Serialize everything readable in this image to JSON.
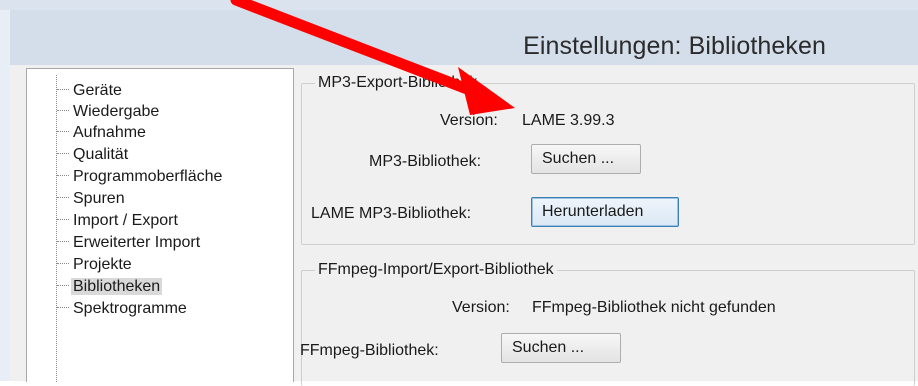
{
  "window": {
    "title": "Einstellungen: Bibliotheken"
  },
  "sidebar": {
    "items": [
      {
        "label": "Geräte"
      },
      {
        "label": "Wiedergabe"
      },
      {
        "label": "Aufnahme"
      },
      {
        "label": "Qualität"
      },
      {
        "label": "Programmoberfläche"
      },
      {
        "label": "Spuren"
      },
      {
        "label": "Import / Export"
      },
      {
        "label": "Erweiterter Import"
      },
      {
        "label": "Projekte"
      },
      {
        "label": "Bibliotheken",
        "selected": true
      },
      {
        "label": "Spektrogramme"
      }
    ]
  },
  "mp3_group": {
    "title": "MP3-Export-Bibliothek",
    "version_label": "Version:",
    "version_value": "LAME 3.99.3",
    "library_label": "MP3-Bibliothek:",
    "search_button": "Suchen ...",
    "lame_label": "LAME MP3-Bibliothek:",
    "download_button": "Herunterladen"
  },
  "ffmpeg_group": {
    "title": "FFmpeg-Import/Export-Bibliothek",
    "version_label": "Version:",
    "version_value": "FFmpeg-Bibliothek nicht gefunden",
    "library_label": "FFmpeg-Bibliothek:",
    "search_button": "Suchen ..."
  },
  "annotation": {
    "arrow_color": "#ff0000"
  }
}
